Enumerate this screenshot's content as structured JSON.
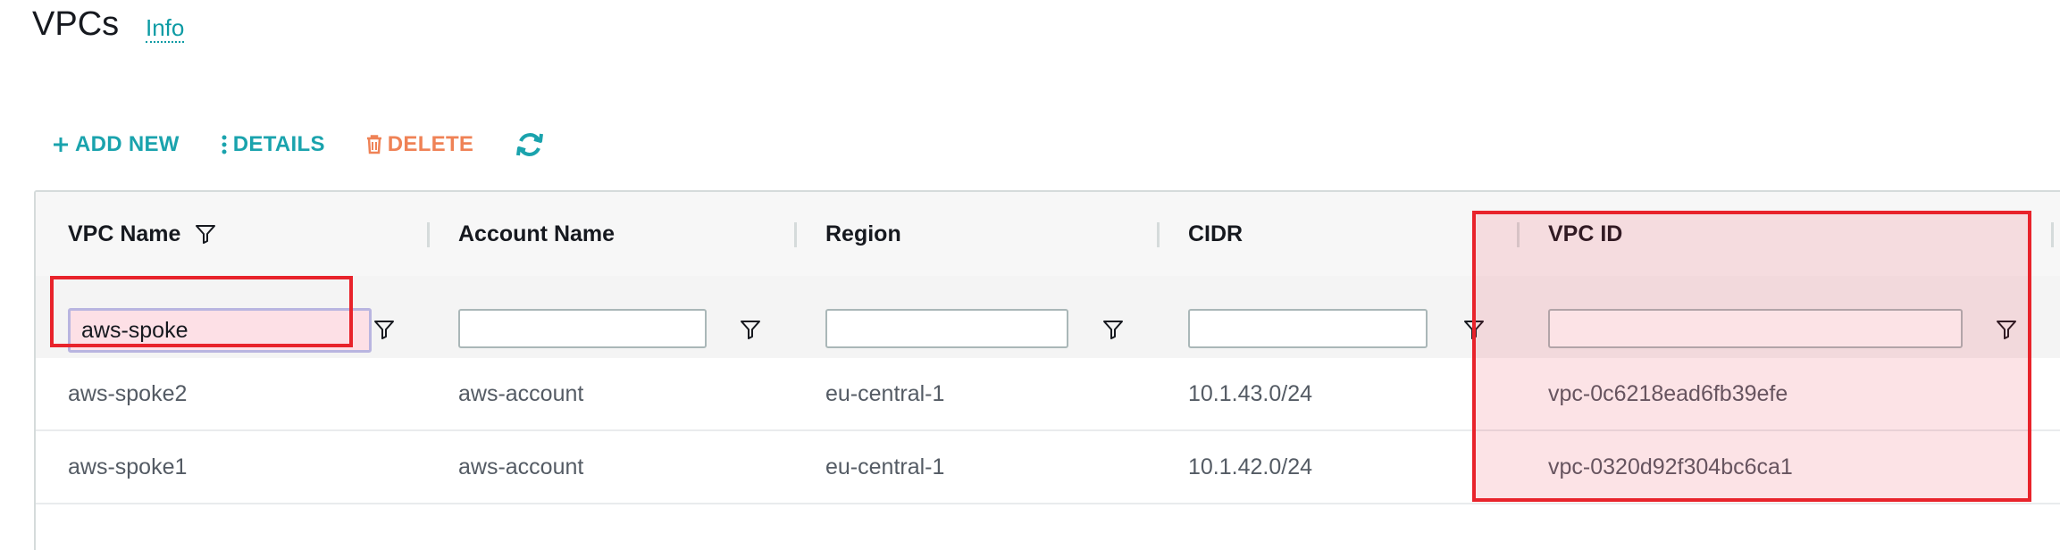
{
  "page": {
    "title": "VPCs",
    "info_link": "Info"
  },
  "toolbar": {
    "add_new": "ADD NEW",
    "details": "DETAILS",
    "delete": "DELETE",
    "refresh_icon": "refresh-icon"
  },
  "table": {
    "columns": [
      {
        "label": "VPC Name",
        "filter_value": "aws-spoke",
        "has_header_filter_icon": true
      },
      {
        "label": "Account Name",
        "filter_value": ""
      },
      {
        "label": "Region",
        "filter_value": ""
      },
      {
        "label": "CIDR",
        "filter_value": ""
      },
      {
        "label": "VPC ID",
        "filter_value": ""
      }
    ],
    "rows": [
      {
        "vpc_name": "aws-spoke2",
        "account_name": "aws-account",
        "region": "eu-central-1",
        "cidr": "10.1.43.0/24",
        "vpc_id": "vpc-0c6218ead6fb39efe"
      },
      {
        "vpc_name": "aws-spoke1",
        "account_name": "aws-account",
        "region": "eu-central-1",
        "cidr": "10.1.42.0/24",
        "vpc_id": "vpc-0320d92f304bc6ca1"
      }
    ]
  },
  "colors": {
    "accent": "#1aa3ad",
    "danger": "#ef8256",
    "highlight_border": "#e8232b"
  }
}
